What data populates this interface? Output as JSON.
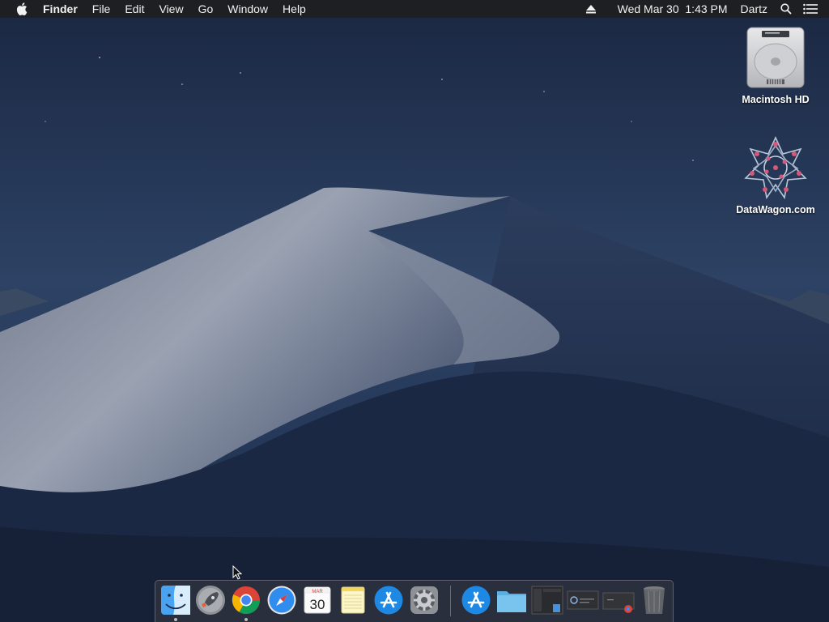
{
  "menubar": {
    "apple_icon": "apple-icon",
    "app_name": "Finder",
    "menus": [
      "File",
      "Edit",
      "View",
      "Go",
      "Window",
      "Help"
    ],
    "datetime": "Wed Mar 30  1:43 PM",
    "user": "Dartz",
    "status_icons": [
      "eject-icon",
      "spotlight-search-icon",
      "notification-center-icon"
    ]
  },
  "desktop": {
    "icons": [
      {
        "label": "Macintosh HD",
        "icon": "hard-drive-icon"
      },
      {
        "label": "DataWagon.com",
        "icon": "datawagon-star-icon"
      }
    ]
  },
  "dock": {
    "apps": [
      {
        "name": "Finder",
        "icon": "finder-icon",
        "running": true
      },
      {
        "name": "Launchpad",
        "icon": "launchpad-rocket-icon",
        "running": false
      },
      {
        "name": "Google Chrome",
        "icon": "chrome-icon",
        "running": true
      },
      {
        "name": "Safari",
        "icon": "safari-compass-icon",
        "running": false
      },
      {
        "name": "Calendar",
        "icon": "calendar-icon",
        "running": false,
        "month": "MAR",
        "day": "30"
      },
      {
        "name": "Notes",
        "icon": "notes-icon",
        "running": false
      },
      {
        "name": "App Store",
        "icon": "app-store-icon",
        "running": false
      },
      {
        "name": "System Preferences",
        "icon": "gear-icon",
        "running": false
      }
    ],
    "others": [
      {
        "name": "Applications",
        "icon": "app-store-icon"
      },
      {
        "name": "Folder",
        "icon": "folder-icon"
      },
      {
        "name": "Minimized window",
        "icon": "window-thumbnail-icon"
      },
      {
        "name": "Minimized window",
        "icon": "window-thumbnail-icon"
      },
      {
        "name": "Minimized Chrome window",
        "icon": "window-thumbnail-icon"
      },
      {
        "name": "Trash",
        "icon": "trash-icon"
      }
    ]
  },
  "colors": {
    "sky_top": "#1d2b47",
    "sky_bottom": "#2f4466",
    "dune_light": "#8f97a8",
    "dune_dark": "#1b2945",
    "menubar_bg": "#1e1e20",
    "dock_bg": "#3c3c42"
  }
}
